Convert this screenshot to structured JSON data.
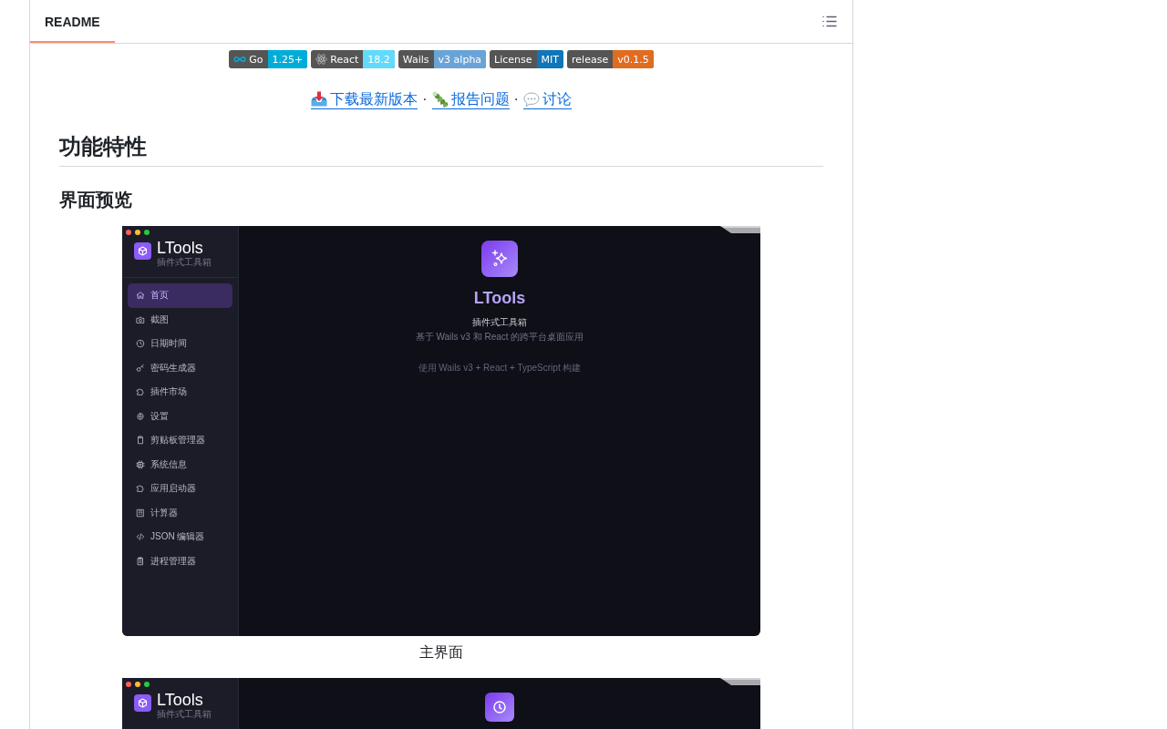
{
  "readme": {
    "tabs": [
      {
        "label": "README",
        "selected": true
      }
    ]
  },
  "badges": [
    {
      "label": "Go",
      "value": "1.25+",
      "color": "#00add8"
    },
    {
      "label": "React",
      "value": "18.2",
      "color": "#61dafb"
    },
    {
      "label": "Wails",
      "value": "v3 alpha",
      "color": "#6aa4d6"
    },
    {
      "label": "License",
      "value": "MIT",
      "color": "#0f76b8"
    },
    {
      "label": "release",
      "value": "v0.1.5",
      "color": "#e06c22"
    }
  ],
  "link_line": [
    {
      "kind": "link",
      "text": "下载最新版本"
    },
    {
      "kind": "separator",
      "text": "·"
    },
    {
      "kind": "link",
      "text": "报告问题"
    },
    {
      "kind": "separator",
      "text": "·"
    },
    {
      "kind": "link",
      "text": "讨论"
    }
  ],
  "heading": "功能特性",
  "subheading": "界面预览",
  "main_screenshot": {
    "app_title": "LTools",
    "app_subtitle": "插件式工具箱",
    "nav": [
      {
        "label": "首页",
        "selected": true
      },
      {
        "label": "截图",
        "selected": false
      },
      {
        "label": "日期时间",
        "selected": false
      },
      {
        "label": "密码生成器",
        "selected": false
      },
      {
        "label": "插件市场",
        "selected": false
      },
      {
        "label": "设置",
        "selected": false
      },
      {
        "label": "剪贴板管理器",
        "selected": false
      },
      {
        "label": "系统信息",
        "selected": false
      },
      {
        "label": "应用启动器",
        "selected": false
      },
      {
        "label": "计算器",
        "selected": false
      },
      {
        "label": "JSON 编辑器",
        "selected": false
      },
      {
        "label": "进程管理器",
        "selected": false
      }
    ],
    "hero": {
      "title": "LTools",
      "subtitle": "插件式工具箱",
      "description": "基于 Wails v3 和 React 的跨平台桌面应用",
      "credit": "使用 Wails v3 + React + TypeScript 构建"
    },
    "caption": "主界面"
  },
  "next_screenshot": {
    "app_title": "LTools",
    "app_subtitle": "插件式工具箱"
  }
}
